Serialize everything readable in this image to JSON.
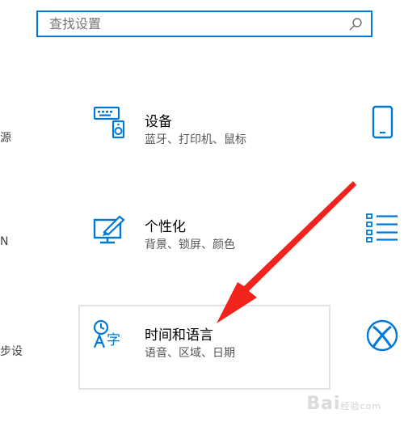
{
  "search": {
    "placeholder": "查找设置"
  },
  "left_fragments": [
    "源",
    "N",
    "步设"
  ],
  "tiles": [
    {
      "title": "设备",
      "desc": "蓝牙、打印机、鼠标",
      "icon": "devices-icon"
    },
    {
      "title": "个性化",
      "desc": "背景、锁屏、颜色",
      "icon": "personalization-icon"
    },
    {
      "title": "时间和语言",
      "desc": "语音、区域、日期",
      "icon": "time-language-icon"
    }
  ],
  "right_icons": [
    "phone-icon",
    "apps-list-icon",
    "xbox-icon"
  ],
  "colors": {
    "accent": "#0078d7",
    "arrow": "#f2231c"
  },
  "watermark": {
    "text": "Bai",
    "sub": "经验",
    "suffix": "com"
  }
}
